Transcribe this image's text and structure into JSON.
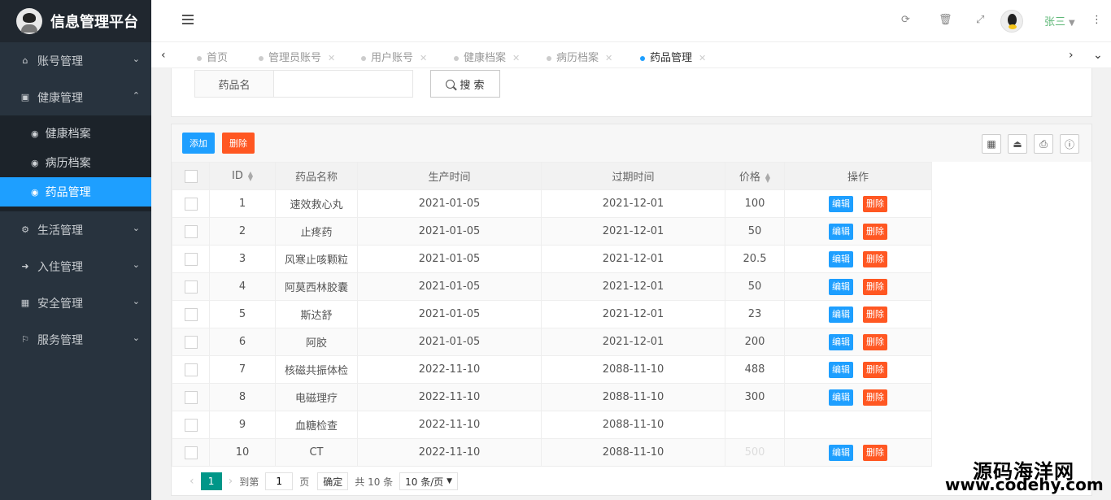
{
  "app": {
    "title": "信息管理平台"
  },
  "sidebar": {
    "items": [
      {
        "label": "账号管理",
        "icon": "home-icon",
        "expanded": false
      },
      {
        "label": "健康管理",
        "icon": "window-icon",
        "expanded": true,
        "children": [
          {
            "label": "健康档案",
            "icon": "dashboard-icon",
            "active": false
          },
          {
            "label": "病历档案",
            "icon": "dashboard-icon",
            "active": false
          },
          {
            "label": "药品管理",
            "icon": "dashboard-icon",
            "active": true
          }
        ]
      },
      {
        "label": "生活管理",
        "icon": "gears-icon",
        "expanded": false
      },
      {
        "label": "入住管理",
        "icon": "login-icon",
        "expanded": false
      },
      {
        "label": "安全管理",
        "icon": "calendar-icon",
        "expanded": false
      },
      {
        "label": "服务管理",
        "icon": "flag-icon",
        "expanded": false
      }
    ]
  },
  "header": {
    "user": "张三"
  },
  "tabs": [
    {
      "label": "首页",
      "closable": false,
      "active": false
    },
    {
      "label": "管理员账号",
      "closable": true,
      "active": false
    },
    {
      "label": "用户账号",
      "closable": true,
      "active": false
    },
    {
      "label": "健康档案",
      "closable": true,
      "active": false
    },
    {
      "label": "病历档案",
      "closable": true,
      "active": false
    },
    {
      "label": "药品管理",
      "closable": true,
      "active": true
    }
  ],
  "search": {
    "label": "药品名",
    "placeholder": "",
    "value": "",
    "button": "搜 索"
  },
  "toolbar": {
    "add": "添加",
    "delete": "删除"
  },
  "table": {
    "columns": [
      "ID",
      "药品名称",
      "生产时间",
      "过期时间",
      "价格",
      "操作"
    ],
    "edit_label": "编辑",
    "delete_label": "删除",
    "rows": [
      {
        "id": "1",
        "name": "速效救心丸",
        "made": "2021-01-05",
        "expire": "2021-12-01",
        "price": "100"
      },
      {
        "id": "2",
        "name": "止疼药",
        "made": "2021-01-05",
        "expire": "2021-12-01",
        "price": "50"
      },
      {
        "id": "3",
        "name": "风寒止咳颗粒",
        "made": "2021-01-05",
        "expire": "2021-12-01",
        "price": "20.5"
      },
      {
        "id": "4",
        "name": "阿莫西林胶囊",
        "made": "2021-01-05",
        "expire": "2021-12-01",
        "price": "50"
      },
      {
        "id": "5",
        "name": "斯达舒",
        "made": "2021-01-05",
        "expire": "2021-12-01",
        "price": "23"
      },
      {
        "id": "6",
        "name": "阿胶",
        "made": "2021-01-05",
        "expire": "2021-12-01",
        "price": "200"
      },
      {
        "id": "7",
        "name": "核磁共振体检",
        "made": "2022-11-10",
        "expire": "2088-11-10",
        "price": "488"
      },
      {
        "id": "8",
        "name": "电磁理疗",
        "made": "2022-11-10",
        "expire": "2088-11-10",
        "price": "300"
      },
      {
        "id": "9",
        "name": "血糖检查",
        "made": "2022-11-10",
        "expire": "2088-11-10",
        "price": ""
      },
      {
        "id": "10",
        "name": "CT",
        "made": "2022-11-10",
        "expire": "2088-11-10",
        "price": "500"
      }
    ]
  },
  "pager": {
    "current": "1",
    "goto_label": "到第",
    "goto_value": "1",
    "page_unit": "页",
    "confirm": "确定",
    "total": "共 10 条",
    "page_size": "10 条/页"
  },
  "watermark": {
    "line1": "源码海洋网",
    "line2": "www.codehy.com"
  },
  "colors": {
    "primary": "#1e9fff",
    "danger": "#ff5722",
    "pager_active": "#009688",
    "sidebar_bg": "#28333e"
  }
}
